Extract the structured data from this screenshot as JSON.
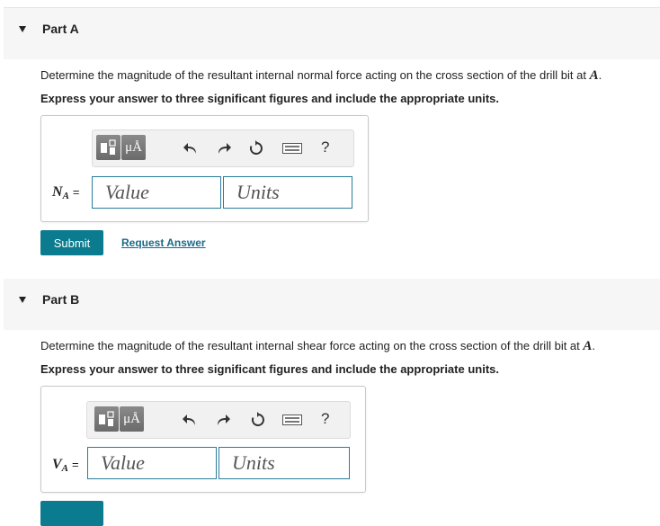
{
  "parts": [
    {
      "title": "Part A",
      "question_text": "Determine the magnitude of the resultant internal normal force acting on the cross section of the drill bit at",
      "point": "A",
      "instructions": "Express your answer to three significant figures and include the appropriate units.",
      "variable": "N",
      "variable_sub": "A",
      "equals": "=",
      "value_placeholder": "Value",
      "units_placeholder": "Units",
      "toolbar": {
        "mu_label": "μÅ",
        "help_label": "?"
      },
      "submit_label": "Submit",
      "request_answer_label": "Request Answer"
    },
    {
      "title": "Part B",
      "question_text": "Determine the magnitude of the resultant internal shear force acting on the cross section of the drill bit at",
      "point": "A",
      "instructions": "Express your answer to three significant figures and include the appropriate units.",
      "variable": "V",
      "variable_sub": "A",
      "equals": "=",
      "value_placeholder": "Value",
      "units_placeholder": "Units",
      "toolbar": {
        "mu_label": "μÅ",
        "help_label": "?"
      }
    }
  ],
  "colors": {
    "accent": "#0b7b8f",
    "link": "#1a6b8a",
    "field_border": "#2a7d9b",
    "header_bg": "#f6f6f6"
  },
  "icons": [
    "template-icon",
    "undo-icon",
    "redo-icon",
    "reset-icon",
    "keyboard-icon"
  ]
}
